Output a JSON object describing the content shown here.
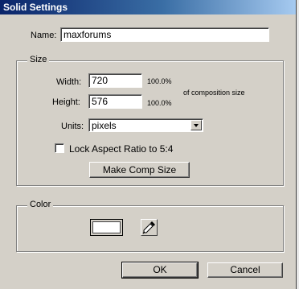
{
  "window": {
    "title": "Solid Settings"
  },
  "name_row": {
    "label": "Name:",
    "value": "maxforums"
  },
  "size_group": {
    "title": "Size",
    "width_label": "Width:",
    "width_value": "720",
    "width_percent": "100.0%",
    "height_label": "Height:",
    "height_value": "576",
    "height_percent": "100.0%",
    "composition_note": "of composition size",
    "units_label": "Units:",
    "units_value": "pixels",
    "lock_aspect_label": "Lock Aspect Ratio to 5:4",
    "lock_aspect_checked": false,
    "make_comp_size_label": "Make Comp Size"
  },
  "color_group": {
    "title": "Color",
    "swatch_color": "#ffffff",
    "eyedropper_icon": "eyedropper-icon"
  },
  "buttons": {
    "ok_label": "OK",
    "cancel_label": "Cancel"
  },
  "colors": {
    "dialog_bg": "#d4d0c8",
    "title_bar": "#0a246a"
  }
}
